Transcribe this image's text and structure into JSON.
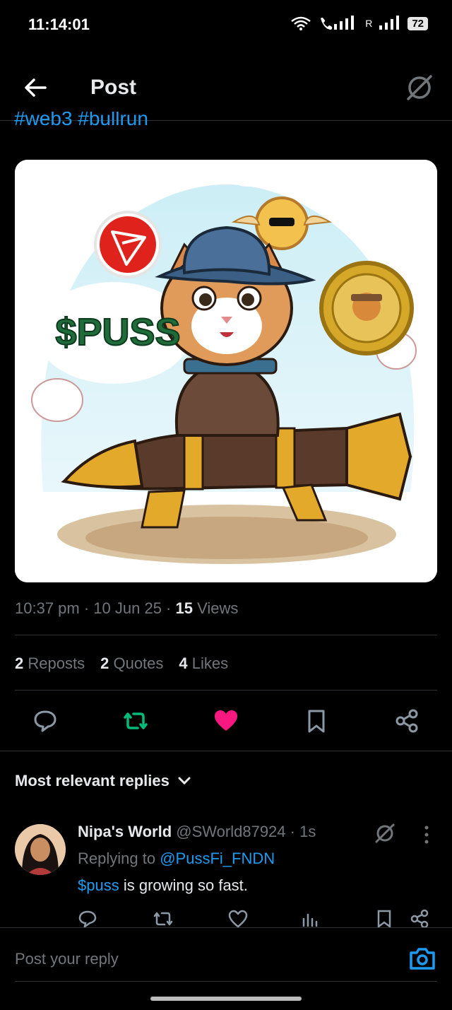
{
  "status": {
    "time": "11:14:01",
    "battery": "72",
    "roaming": "R"
  },
  "header": {
    "title": "Post"
  },
  "post": {
    "hashtags": "#web3 #bullrun",
    "image_text": "$PUSS",
    "meta": {
      "time": "10:37 pm",
      "date": "10 Jun 25",
      "views_count": "15",
      "views_label": "Views"
    },
    "counts": [
      {
        "num": "2",
        "label": "Reposts"
      },
      {
        "num": "2",
        "label": "Quotes"
      },
      {
        "num": "4",
        "label": "Likes"
      }
    ],
    "colors": {
      "retweet": "#00ba7c",
      "like": "#f91880",
      "link": "#1d9bf0"
    }
  },
  "replies_sort": {
    "label": "Most relevant replies"
  },
  "reply": {
    "name": "Nipa's World",
    "handle": "@SWorld87924",
    "time": "1s",
    "replying_prefix": "Replying to",
    "replying_to": "@PussFi_FNDN",
    "cashtag": "$puss",
    "text": " is growing so fast."
  },
  "composer": {
    "placeholder": "Post your reply"
  }
}
